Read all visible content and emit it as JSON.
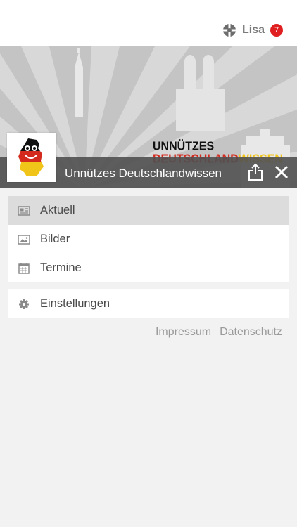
{
  "topbar": {
    "user_name": "Lisa",
    "notification_count": "7",
    "brand_icon": "app-logo-icon"
  },
  "hero": {
    "logo_line1": "UNNÜTZES",
    "logo_line2_red": "DEUTSCHLAND",
    "logo_line2_yellow": "WISSEN",
    "title": "Unnützes Deutschlandwissen",
    "share_icon": "share-icon",
    "close_icon": "close-icon"
  },
  "menu": {
    "items": [
      {
        "label": "Aktuell",
        "icon": "newspaper-icon",
        "active": true
      },
      {
        "label": "Bilder",
        "icon": "image-icon",
        "active": false
      },
      {
        "label": "Termine",
        "icon": "calendar-icon",
        "active": false
      }
    ],
    "settings": {
      "label": "Einstellungen",
      "icon": "gear-icon"
    }
  },
  "footer": {
    "impressum": "Impressum",
    "datenschutz": "Datenschutz"
  },
  "colors": {
    "accent_red": "#d42a1e",
    "accent_yellow": "#f0c419",
    "badge": "#e02020"
  }
}
